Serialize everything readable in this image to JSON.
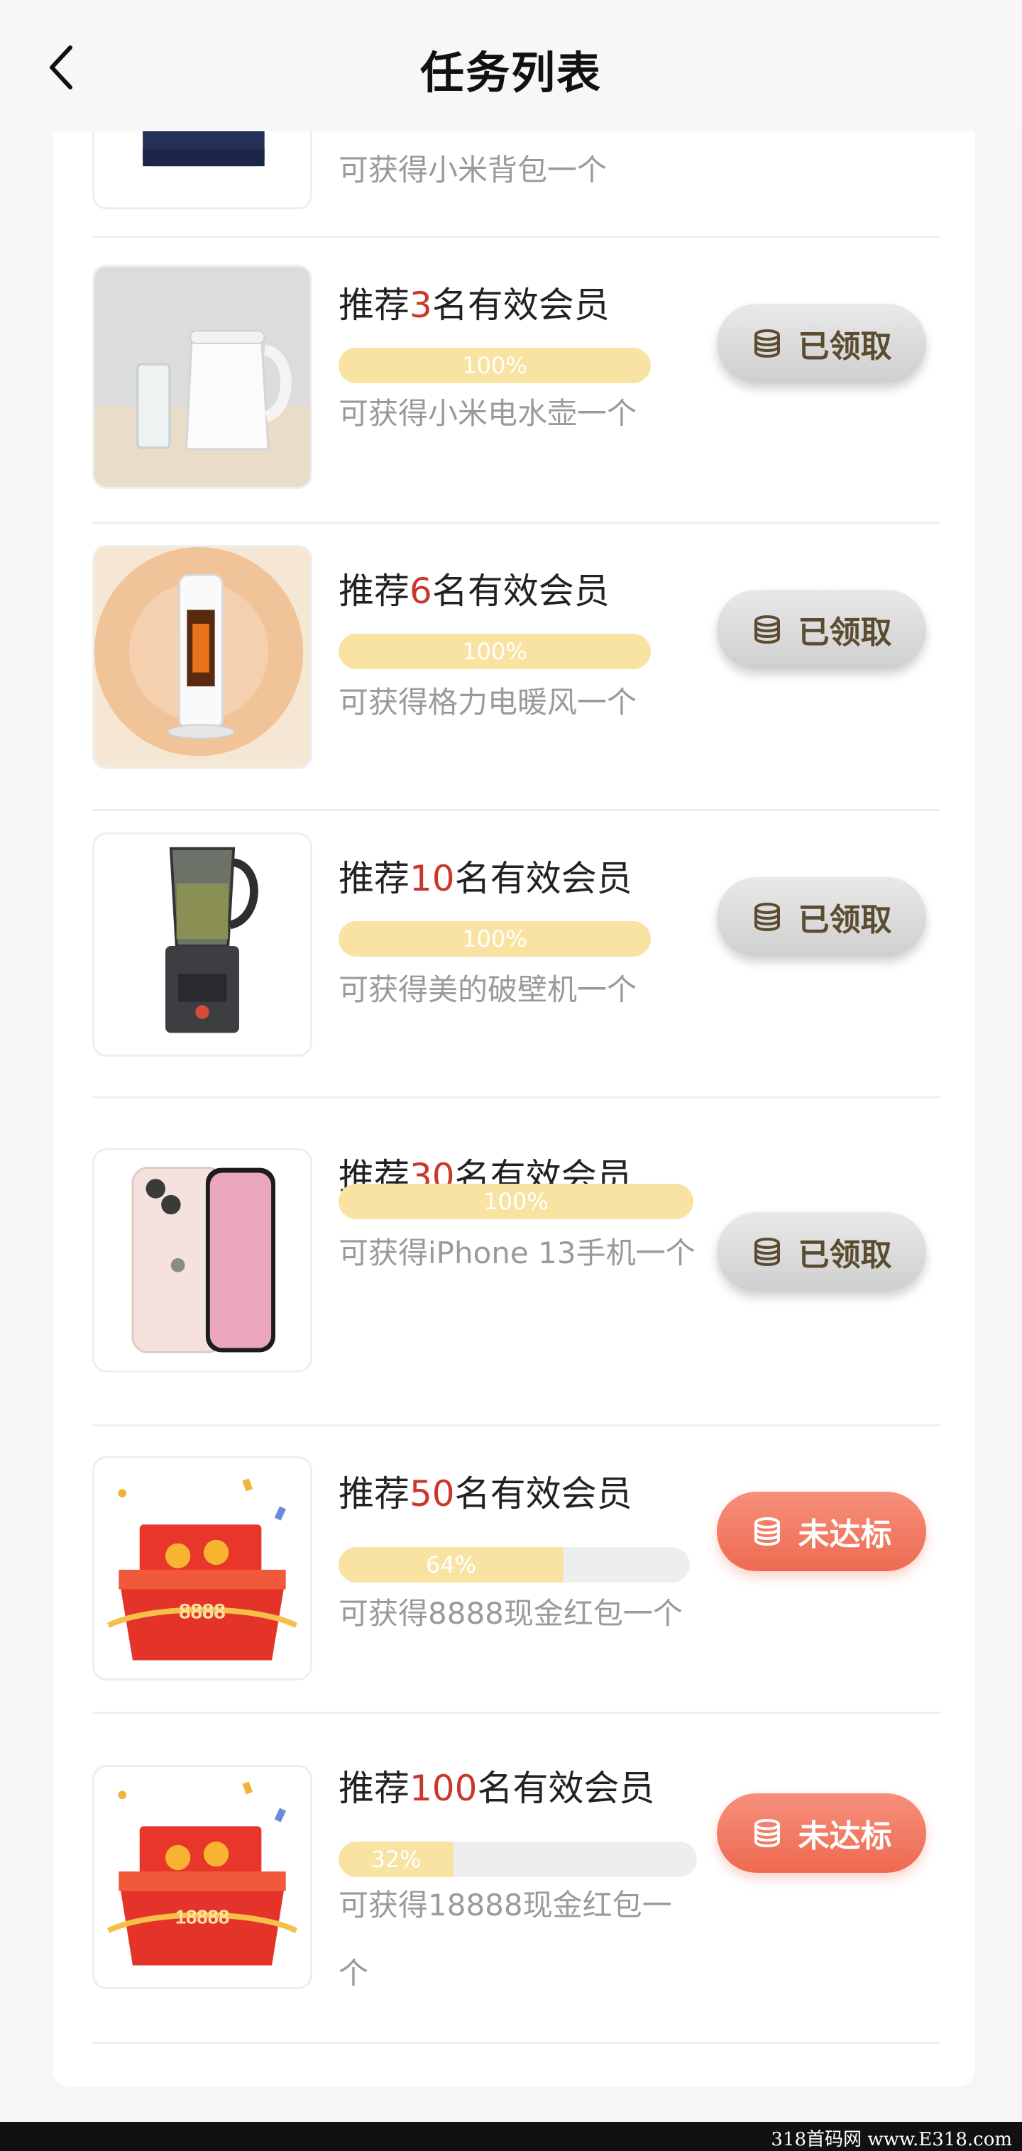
{
  "header": {
    "title": "任务列表",
    "back_icon": "chevron-left-icon"
  },
  "tasks": [
    {
      "image": "xiaomi-backpack",
      "title_prefix": "",
      "title_num": "",
      "title_suffix": "",
      "reward": "可获得小米背包一个"
    },
    {
      "image": "xiaomi-kettle",
      "title_prefix": "推荐",
      "title_num": "3",
      "title_suffix": "名有效会员",
      "progress": 1.0,
      "progress_label": "100%",
      "reward": "可获得小米电水壶一个",
      "button": "已领取",
      "status": "claimed"
    },
    {
      "image": "gree-heater",
      "title_prefix": "推荐",
      "title_num": "6",
      "title_suffix": "名有效会员",
      "progress": 1.0,
      "progress_label": "100%",
      "reward": "可获得格力电暖风一个",
      "button": "已领取",
      "status": "claimed"
    },
    {
      "image": "midea-blender",
      "title_prefix": "推荐",
      "title_num": "10",
      "title_suffix": "名有效会员",
      "progress": 1.0,
      "progress_label": "100%",
      "reward": "可获得美的破壁机一个",
      "button": "已领取",
      "status": "claimed"
    },
    {
      "image": "iphone-13",
      "title_prefix": "推荐",
      "title_num": "30",
      "title_suffix": "名有效会员",
      "progress": 1.0,
      "progress_label": "100%",
      "reward": "可获得iPhone 13手机一个",
      "button": "已领取",
      "status": "claimed"
    },
    {
      "image": "red-envelope",
      "image_text": "8888",
      "title_prefix": "推荐",
      "title_num": "50",
      "title_suffix": "名有效会员",
      "progress": 0.64,
      "progress_label": "64%",
      "reward": "可获得8888现金红包一个",
      "button": "未达标",
      "status": "pending"
    },
    {
      "image": "red-envelope",
      "image_text": "18888",
      "title_prefix": "推荐",
      "title_num": "100",
      "title_suffix": "名有效会员",
      "progress": 0.32,
      "progress_label": "32%",
      "reward": "可获得18888现金红包一个",
      "button": "未达标",
      "status": "pending"
    }
  ],
  "colors": {
    "accent_number": "#c9382a",
    "progress_fill": "#f9e3a3",
    "progress_track": "#eeeeee",
    "pending_button": "#ee6a50",
    "claimed_button": "#d9d9d9"
  },
  "watermark": "318首码网 www.E318.com"
}
